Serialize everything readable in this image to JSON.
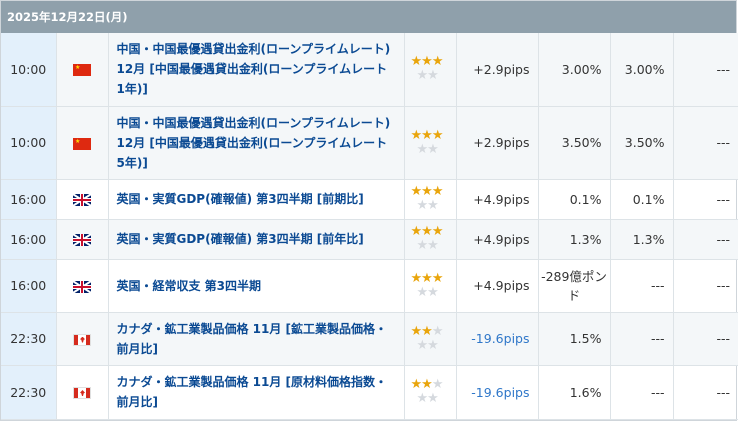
{
  "header": {
    "date": "2025年12月22日(月)"
  },
  "rows": [
    {
      "time": "10:00",
      "country": "china",
      "event": "中国・中国最優遇貸出金利(ローンプライムレート) 12月 [中国最優遇貸出金利(ローンプライムレート　1年)]",
      "stars": 3,
      "pips": "+2.9pips",
      "actual": "3.00%",
      "forecast": "3.00%",
      "previous": "---",
      "shade": true
    },
    {
      "time": "10:00",
      "country": "china",
      "event": "中国・中国最優遇貸出金利(ローンプライムレート) 12月 [中国最優遇貸出金利(ローンプライムレート　5年)]",
      "stars": 3,
      "pips": "+2.9pips",
      "actual": "3.50%",
      "forecast": "3.50%",
      "previous": "---",
      "shade": true
    },
    {
      "time": "16:00",
      "country": "uk",
      "event": "英国・実質GDP(確報値) 第3四半期 [前期比]",
      "stars": 3,
      "pips": "+4.9pips",
      "actual": "0.1%",
      "forecast": "0.1%",
      "previous": "---",
      "shade": false
    },
    {
      "time": "16:00",
      "country": "uk",
      "event": "英国・実質GDP(確報値) 第3四半期 [前年比]",
      "stars": 3,
      "pips": "+4.9pips",
      "actual": "1.3%",
      "forecast": "1.3%",
      "previous": "---",
      "shade": true
    },
    {
      "time": "16:00",
      "country": "uk",
      "event": "英国・経常収支 第3四半期",
      "stars": 3,
      "pips": "+4.9pips",
      "actual": "-289億ポンド",
      "forecast": "---",
      "previous": "---",
      "shade": false
    },
    {
      "time": "22:30",
      "country": "canada",
      "event": "カナダ・鉱工業製品価格 11月 [鉱工業製品価格・前月比]",
      "stars": 2,
      "pips": "-19.6pips",
      "actual": "1.5%",
      "forecast": "---",
      "previous": "---",
      "shade": true
    },
    {
      "time": "22:30",
      "country": "canada",
      "event": "カナダ・鉱工業製品価格 11月 [原材料価格指数・前月比]",
      "stars": 2,
      "pips": "-19.6pips",
      "actual": "1.6%",
      "forecast": "---",
      "previous": "---",
      "shade": false
    }
  ],
  "colors": {
    "header_bg": "#8fa0ab",
    "event_link": "#0b4a93",
    "time_bg": "#e3f0fb",
    "star_on": "#e9a50c",
    "negative_pips": "#2f77c9"
  },
  "icons": {
    "china": "china-flag-icon",
    "uk": "uk-flag-icon",
    "canada": "canada-flag-icon",
    "star": "star-icon"
  }
}
